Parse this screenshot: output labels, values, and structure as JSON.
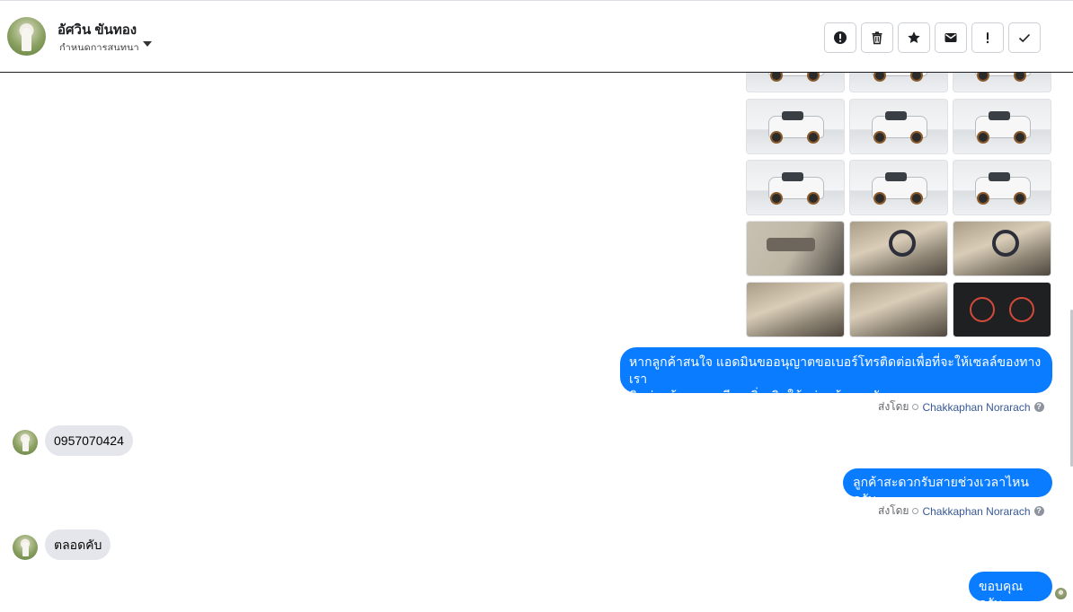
{
  "header": {
    "contact_name": "อัศวิน ขันทอง",
    "subtitle": "กำหนดการสนทนา",
    "actions": [
      {
        "name": "report-button",
        "icon": "alert-circle-icon"
      },
      {
        "name": "delete-button",
        "icon": "trash-icon"
      },
      {
        "name": "star-button",
        "icon": "star-icon"
      },
      {
        "name": "mark-unread-button",
        "icon": "envelope-icon"
      },
      {
        "name": "important-button",
        "icon": "exclamation-icon"
      },
      {
        "name": "done-button",
        "icon": "check-icon"
      }
    ]
  },
  "attachments": {
    "thumbnails": [
      {
        "kind": "car-front"
      },
      {
        "kind": "car-front"
      },
      {
        "kind": "car-front"
      },
      {
        "kind": "car-side"
      },
      {
        "kind": "car-rear"
      },
      {
        "kind": "car-rear"
      },
      {
        "kind": "car-side"
      },
      {
        "kind": "car-side"
      },
      {
        "kind": "car-wheel"
      },
      {
        "kind": "interior-door"
      },
      {
        "kind": "interior-steering"
      },
      {
        "kind": "interior-steering"
      },
      {
        "kind": "interior-seat"
      },
      {
        "kind": "interior-seat"
      },
      {
        "kind": "gauge-cluster"
      }
    ]
  },
  "messages": [
    {
      "direction": "outgoing",
      "lines": [
        "หากลูกค้าสนใจ แอดมินขออนุญาตขอเบอร์โทรติดต่อเพื่อที่จะให้เซลล์ของทางเรา",
        "ติดต่อแจ้งรายละเอียดเพิ่มเติมให้แก่ลูกค้านะครับ"
      ],
      "sent_by_label": "ส่งโดย",
      "agent": "Chakkaphan Norarach"
    },
    {
      "direction": "incoming",
      "text": "0957070424"
    },
    {
      "direction": "outgoing",
      "text": "ลูกค้าสะดวกรับสายช่วงเวลาไหนครับ",
      "sent_by_label": "ส่งโดย",
      "agent": "Chakkaphan Norarach"
    },
    {
      "direction": "incoming",
      "text": "ตลอดคับ"
    },
    {
      "direction": "outgoing",
      "text": "ขอบคุณครับ"
    }
  ],
  "colors": {
    "outgoing_bubble": "#0a7cff",
    "incoming_bubble": "#e4e6eb",
    "agent_link": "#385898"
  }
}
